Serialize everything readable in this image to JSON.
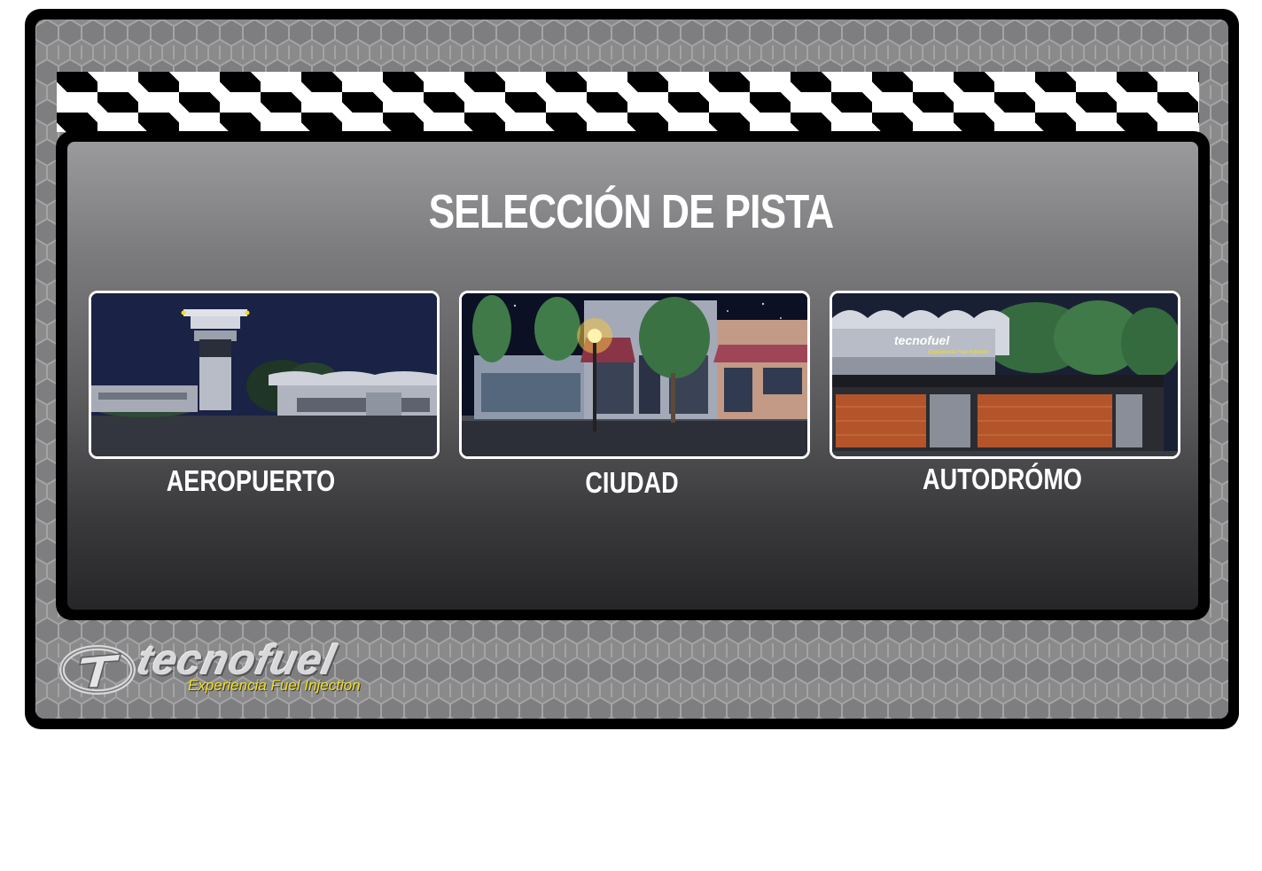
{
  "screen": {
    "title": "SELECCIÓN DE PISTA"
  },
  "tracks": [
    {
      "id": "aeropuerto",
      "label": "AEROPUERTO"
    },
    {
      "id": "ciudad",
      "label": "CIUDAD"
    },
    {
      "id": "autodromo",
      "label": "AUTODRÓMO"
    }
  ],
  "brand": {
    "name": "tecnofuel",
    "tagline": "Experiencia Fuel Injection",
    "sign_name": "tecnofuel",
    "sign_tagline": "Experiencia Fuel Injection"
  },
  "colors": {
    "frame": "#000000",
    "hex_background": "#8a8a8a",
    "panel_top": "#9a9a9c",
    "panel_bottom": "#262628",
    "label": "#ffffff",
    "tagline": "#f2df1a",
    "card_border": "#ffffff"
  },
  "icons": {
    "logo_emblem": "tecnofuel-t-emblem-icon"
  }
}
